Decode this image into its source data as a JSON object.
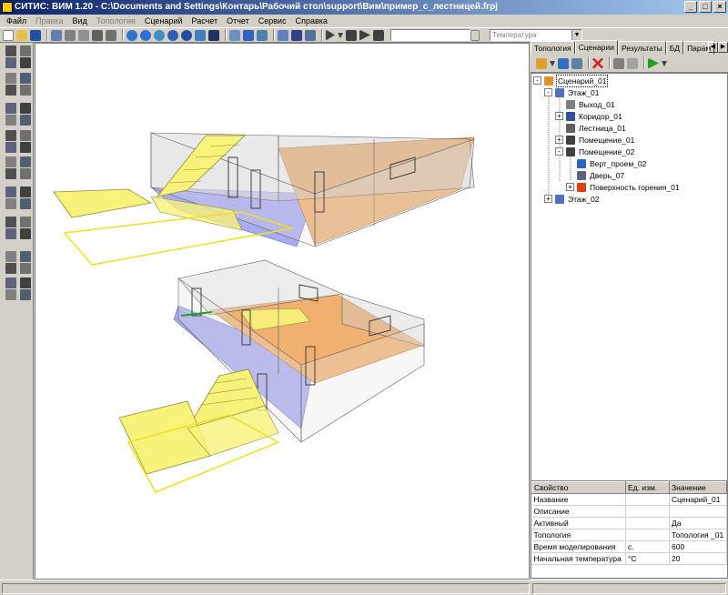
{
  "window": {
    "title": "СИТИС: ВИМ 1.20 - C:\\Documents and Settings\\Контарь\\Рабочий стол\\support\\Вим\\пример_с_лестницей.frpj"
  },
  "menu": [
    {
      "label": "Файл",
      "disabled": false
    },
    {
      "label": "Правка",
      "disabled": true
    },
    {
      "label": "Вид",
      "disabled": false
    },
    {
      "label": "Топология",
      "disabled": true
    },
    {
      "label": "Сценарий",
      "disabled": false
    },
    {
      "label": "Расчет",
      "disabled": false
    },
    {
      "label": "Отчет",
      "disabled": false
    },
    {
      "label": "Сервис",
      "disabled": false
    },
    {
      "label": "Справка",
      "disabled": false
    }
  ],
  "toolbar": {
    "parameter_combo": "Температура"
  },
  "panel": {
    "tabs": [
      "Топология",
      "Сценарии",
      "Результаты",
      "БД",
      "Парам"
    ],
    "active_tab": "Сценарии",
    "tree": [
      {
        "label": "Сценарий_01",
        "level": 0,
        "icon": "scenario-icon",
        "expander": "-",
        "selected": true
      },
      {
        "label": "Этаж_01",
        "level": 1,
        "icon": "floor-icon",
        "expander": "-"
      },
      {
        "label": "Выход_01",
        "level": 2,
        "icon": "exit-icon",
        "expander": ""
      },
      {
        "label": "Коридор_01",
        "level": 2,
        "icon": "corridor-icon",
        "expander": "+"
      },
      {
        "label": "Лестница_01",
        "level": 2,
        "icon": "stairs-icon",
        "expander": ""
      },
      {
        "label": "Помещение_01",
        "level": 2,
        "icon": "room-icon",
        "expander": "+"
      },
      {
        "label": "Помещение_02",
        "level": 2,
        "icon": "room-icon",
        "expander": "-"
      },
      {
        "label": "Верт_проем_02",
        "level": 3,
        "icon": "opening-icon",
        "expander": ""
      },
      {
        "label": "Дверь_07",
        "level": 3,
        "icon": "door-icon",
        "expander": ""
      },
      {
        "label": "Поверхность горения_01",
        "level": 3,
        "icon": "fire-icon",
        "expander": "+"
      },
      {
        "label": "Этаж_02",
        "level": 1,
        "icon": "floor-icon",
        "expander": "+"
      }
    ],
    "props": {
      "headers": [
        "Свойство",
        "Ед. изм.",
        "Значение"
      ],
      "rows": [
        [
          "Название",
          "",
          "Сценарий_01"
        ],
        [
          "Описание",
          "",
          ""
        ],
        [
          "Активный",
          "",
          "Да"
        ],
        [
          "Топология",
          "",
          "Топология _01"
        ],
        [
          "Время моделирования",
          "с.",
          "600"
        ],
        [
          "Начальная температура",
          "°C",
          "20"
        ]
      ]
    }
  },
  "colors": {
    "floor_blue": "#aaaaf0",
    "floor_orange": "#f0b070",
    "stairs_yellow": "#f7f27a",
    "wall_gray": "#d8d8d8",
    "titlebar": "#0a246a"
  }
}
